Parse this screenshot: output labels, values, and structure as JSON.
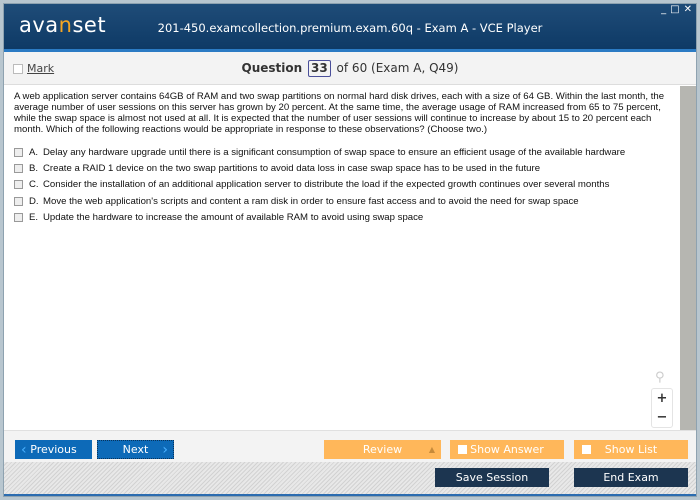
{
  "app": {
    "logo_prefix": "ava",
    "logo_highlight": "n",
    "logo_suffix": "set",
    "title": "201-450.examcollection.premium.exam.60q - Exam A - VCE Player",
    "window_controls": {
      "minimize": "_",
      "maximize": "□",
      "close": "✕"
    }
  },
  "question_bar": {
    "mark_label": "Mark",
    "question_label": "Question",
    "current": "33",
    "of_text": "of 60 (Exam A, Q49)"
  },
  "question": {
    "text": "A web application server contains 64GB of RAM and two swap partitions on normal hard disk drives, each with a size of 64 GB. Within the last month, the average number of user sessions on this server has grown by 20 percent. At the same time, the average usage of RAM increased from 65 to 75 percent, while the swap space is almost not used at all. It is expected that the number of user sessions will continue to increase by about 15 to 20 percent each month. Which of the following reactions would be appropriate in response to these observations? (Choose two.)",
    "options": [
      {
        "letter": "A.",
        "text": "Delay any hardware upgrade until there is a significant consumption of swap space to ensure an efficient usage of the available hardware"
      },
      {
        "letter": "B.",
        "text": "Create a RAID 1 device on the two swap partitions to avoid data loss in case swap space has to be used in the future"
      },
      {
        "letter": "C.",
        "text": "Consider the installation of an additional application server to distribute the load if the expected growth continues over several months"
      },
      {
        "letter": "D.",
        "text": "Move the web application's scripts and content a ram disk in order to ensure fast access and to avoid the need for swap space"
      },
      {
        "letter": "E.",
        "text": "Update the hardware to increase the amount of available RAM to avoid using swap space"
      }
    ]
  },
  "zoom": {
    "magnifier": "⚲",
    "plus": "+",
    "minus": "−"
  },
  "nav": {
    "previous": "Previous",
    "next": "Next",
    "review": "Review",
    "show_answer": "Show Answer",
    "show_list": "Show List",
    "prev_chevron": "‹",
    "next_chevron": "›",
    "review_arrow": "▲"
  },
  "footer": {
    "save_session": "Save Session",
    "end_exam": "End Exam"
  }
}
